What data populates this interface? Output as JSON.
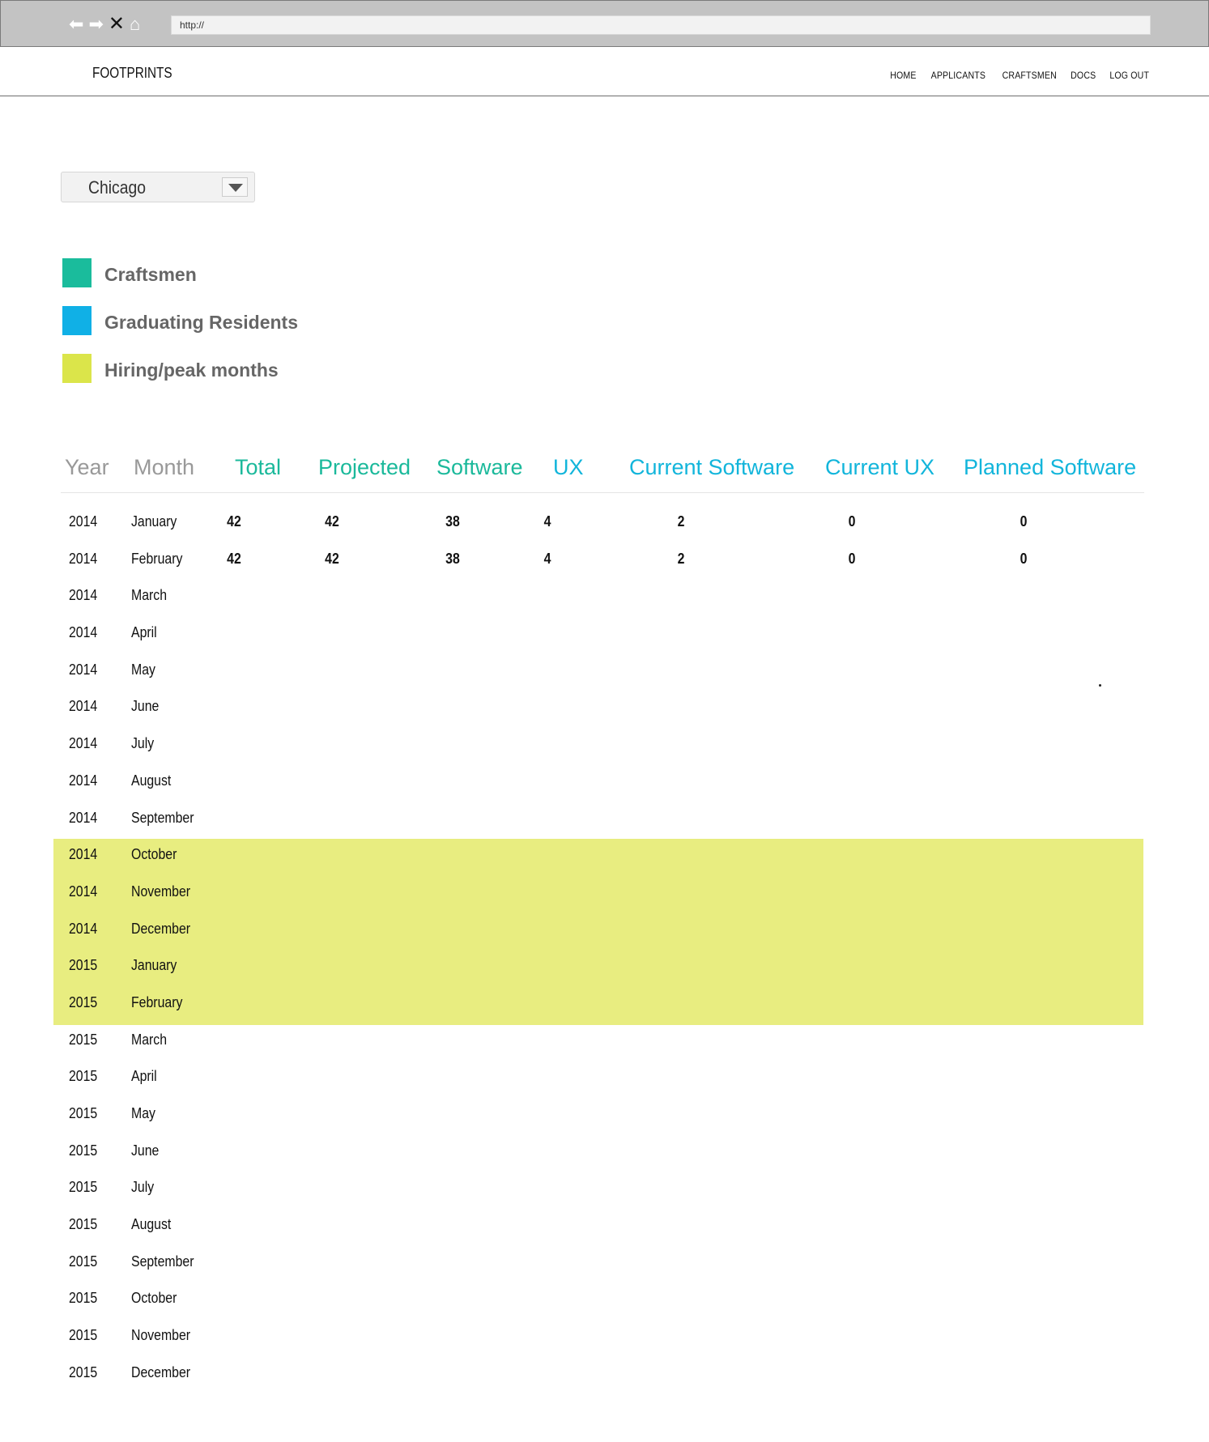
{
  "browser": {
    "address": "http://"
  },
  "header": {
    "brand": "FOOTPRINTS",
    "nav": [
      "HOME",
      "APPLICANTS",
      "CRAFTSMEN",
      "DOCS",
      "LOG OUT"
    ]
  },
  "location_select": {
    "value": "Chicago"
  },
  "legend": [
    {
      "label": "Craftsmen",
      "color": "#1abc9c"
    },
    {
      "label": "Graduating  Residents",
      "color": "#10b0e6"
    },
    {
      "label": "Hiring/peak months",
      "color": "#dbe54a"
    }
  ],
  "table": {
    "headers": [
      "Year",
      "Month",
      "Total",
      "Projected",
      "Software",
      "UX",
      "Current Software",
      "Current UX",
      "Planned Software"
    ],
    "rows": [
      {
        "year": "2014",
        "month": "January",
        "total": "42",
        "projected": "42",
        "software": "38",
        "ux": "4",
        "current_software": "2",
        "current_ux": "0",
        "planned_software": "0",
        "peak": false
      },
      {
        "year": "2014",
        "month": "February",
        "total": "42",
        "projected": "42",
        "software": "38",
        "ux": "4",
        "current_software": "2",
        "current_ux": "0",
        "planned_software": "0",
        "peak": false
      },
      {
        "year": "2014",
        "month": "March",
        "peak": false
      },
      {
        "year": "2014",
        "month": "April",
        "peak": false
      },
      {
        "year": "2014",
        "month": "May",
        "peak": false
      },
      {
        "year": "2014",
        "month": "June",
        "peak": false
      },
      {
        "year": "2014",
        "month": "July",
        "peak": false
      },
      {
        "year": "2014",
        "month": "August",
        "peak": false
      },
      {
        "year": "2014",
        "month": "September",
        "peak": false
      },
      {
        "year": "2014",
        "month": "October",
        "peak": true
      },
      {
        "year": "2014",
        "month": "November",
        "peak": true
      },
      {
        "year": "2014",
        "month": "December",
        "peak": true
      },
      {
        "year": "2015",
        "month": "January",
        "peak": true
      },
      {
        "year": "2015",
        "month": "February",
        "peak": true
      },
      {
        "year": "2015",
        "month": "March",
        "peak": false
      },
      {
        "year": "2015",
        "month": "April",
        "peak": false
      },
      {
        "year": "2015",
        "month": "May",
        "peak": false
      },
      {
        "year": "2015",
        "month": "June",
        "peak": false
      },
      {
        "year": "2015",
        "month": "July",
        "peak": false
      },
      {
        "year": "2015",
        "month": "August",
        "peak": false
      },
      {
        "year": "2015",
        "month": "September",
        "peak": false
      },
      {
        "year": "2015",
        "month": "October",
        "peak": false
      },
      {
        "year": "2015",
        "month": "November",
        "peak": false
      },
      {
        "year": "2015",
        "month": "December",
        "peak": false
      }
    ]
  }
}
